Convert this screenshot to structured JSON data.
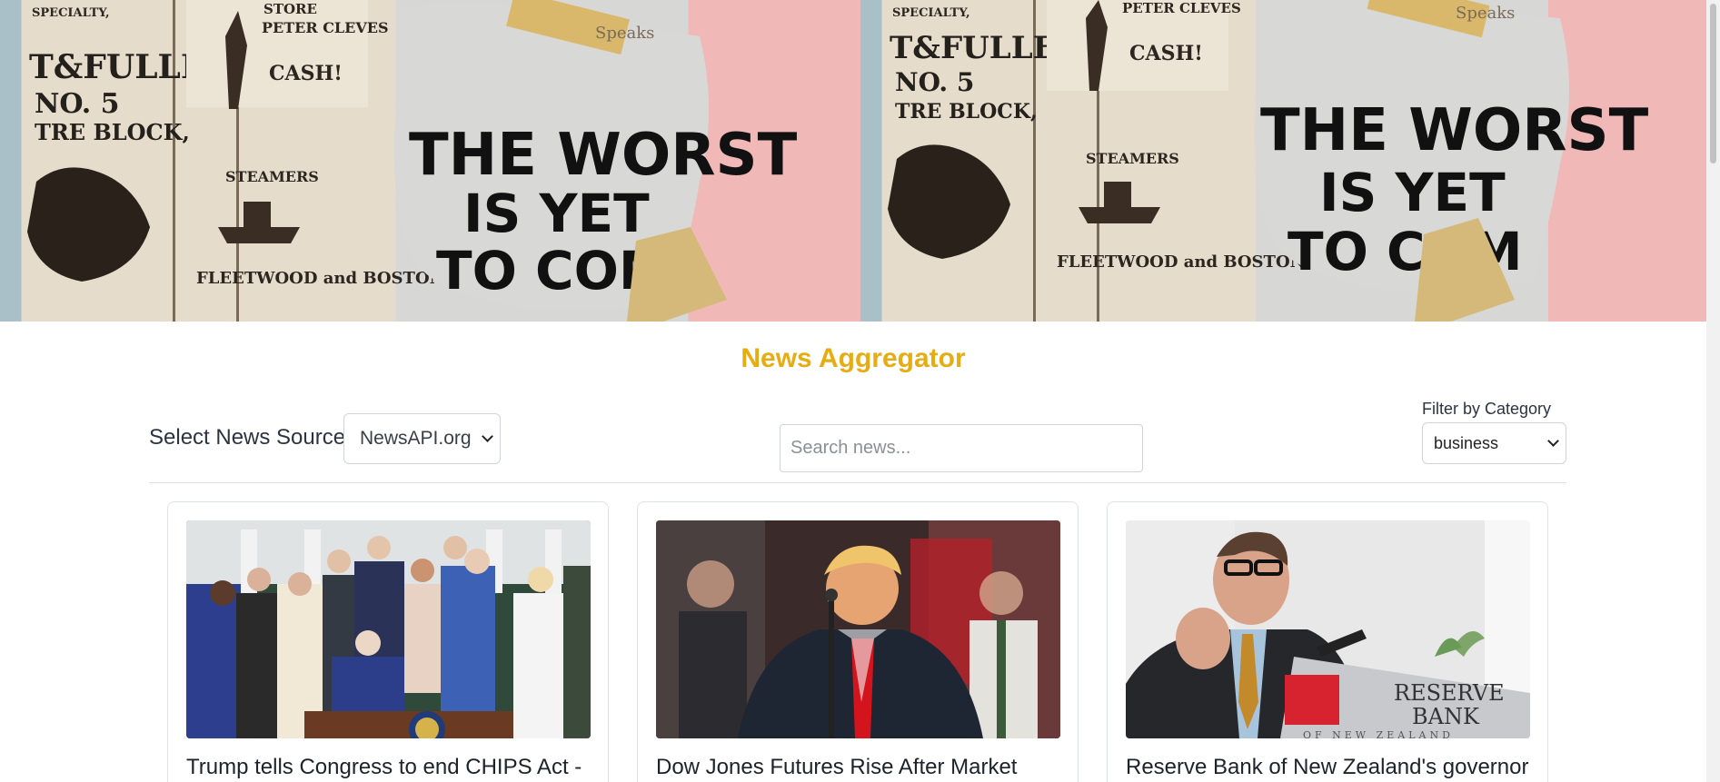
{
  "hero": {
    "image_text": [
      "THE WORST",
      "IS YET",
      "TO COM",
      "T&FULLER",
      "NO. 5",
      "TRE BLOCK,",
      "PETER CLEVES",
      "CASH!",
      "STEAMERS",
      "FLEETWOOD and BOSTONA",
      "SPECIALTY,",
      "Speaks"
    ]
  },
  "app": {
    "title": "News Aggregator"
  },
  "controls": {
    "source_label": "Select News Source:",
    "source_value": "NewsAPI.org",
    "search_placeholder": "Search news...",
    "category_label": "Filter by Category",
    "category_value": "business"
  },
  "articles": [
    {
      "title": "Trump tells Congress to end CHIPS Act -"
    },
    {
      "title": "Dow Jones Futures Rise After Market"
    },
    {
      "title": "Reserve Bank of New Zealand's governor",
      "image_text": [
        "RESERVE",
        "BANK",
        "OF NEW ZEALAND"
      ]
    }
  ],
  "colors": {
    "title_accent": "#e6ac12",
    "border": "#dfe2e6"
  }
}
